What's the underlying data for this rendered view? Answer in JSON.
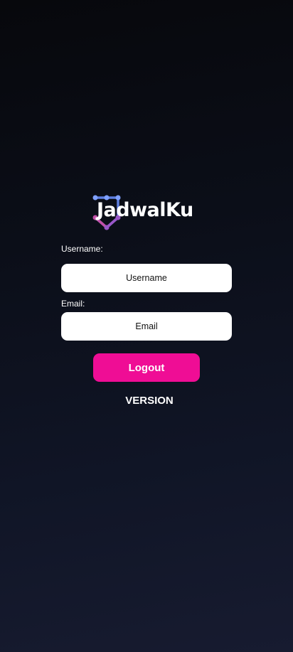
{
  "app": {
    "logo_text": "JadwalKu",
    "logo_icon": "connected-nodes-icon",
    "colors": {
      "accent": "#ef0d95",
      "node_blue": "#5e7fe0",
      "node_purple": "#9a56c8"
    }
  },
  "form": {
    "username_label": "Username:",
    "username_placeholder": "Username",
    "email_label": "Email:",
    "email_placeholder": "Email"
  },
  "actions": {
    "logout_label": "Logout"
  },
  "footer": {
    "version_text": "VERSION"
  }
}
